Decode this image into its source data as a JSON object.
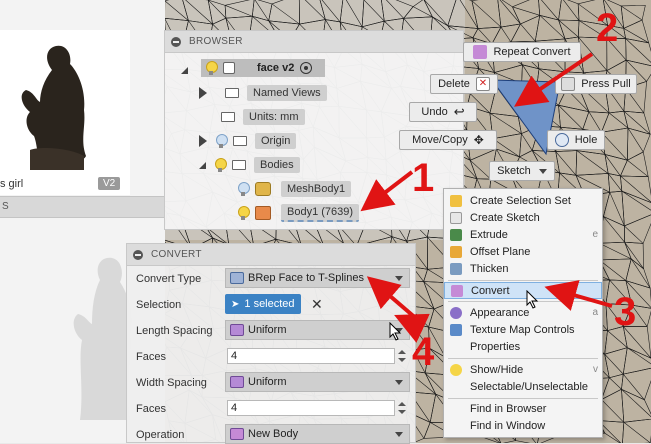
{
  "data_panel": {
    "thumb_label": "s girl",
    "thumb_version": "V2",
    "strip_text": "S"
  },
  "browser": {
    "title": "BROWSER",
    "root": "face v2",
    "named_views": "Named Views",
    "units": "Units: mm",
    "origin": "Origin",
    "bodies": "Bodies",
    "mesh_body": "MeshBody1",
    "body1": "Body1 (7639)"
  },
  "convert": {
    "title": "CONVERT",
    "convert_type_label": "Convert Type",
    "convert_type_value": "BRep Face to T-Splines",
    "selection_label": "Selection",
    "selection_value": "1 selected",
    "length_spacing_label": "Length Spacing",
    "length_spacing_value": "Uniform",
    "faces_label_1": "Faces",
    "faces_value_1": "4",
    "width_spacing_label": "Width Spacing",
    "width_spacing_value": "Uniform",
    "faces_label_2": "Faces",
    "faces_value_2": "4",
    "operation_label": "Operation",
    "operation_value": "New Body"
  },
  "marking_menu": {
    "repeat": "Repeat Convert",
    "delete": "Delete",
    "press_pull": "Press Pull",
    "undo": "Undo",
    "move_copy": "Move/Copy",
    "hole": "Hole",
    "sketch": "Sketch"
  },
  "context_menu": {
    "items": [
      {
        "label": "Create Selection Set",
        "shortcut": ""
      },
      {
        "label": "Create Sketch",
        "shortcut": ""
      },
      {
        "label": "Extrude",
        "shortcut": "e"
      },
      {
        "label": "Offset Plane",
        "shortcut": ""
      },
      {
        "label": "Thicken",
        "shortcut": ""
      },
      {
        "label": "Convert",
        "shortcut": ""
      },
      {
        "label": "Appearance",
        "shortcut": "a"
      },
      {
        "label": "Texture Map Controls",
        "shortcut": ""
      },
      {
        "label": "Properties",
        "shortcut": ""
      },
      {
        "label": "Show/Hide",
        "shortcut": "v"
      },
      {
        "label": "Selectable/Unselectable",
        "shortcut": ""
      },
      {
        "label": "Find in Browser",
        "shortcut": ""
      },
      {
        "label": "Find in Window",
        "shortcut": ""
      }
    ]
  },
  "annotations": {
    "n1": "1",
    "n2": "2",
    "n3": "3",
    "n4": "4"
  },
  "colors": {
    "accent": "#3b82c4",
    "annotation": "#e01414",
    "highlight": "#cfe3f7"
  }
}
